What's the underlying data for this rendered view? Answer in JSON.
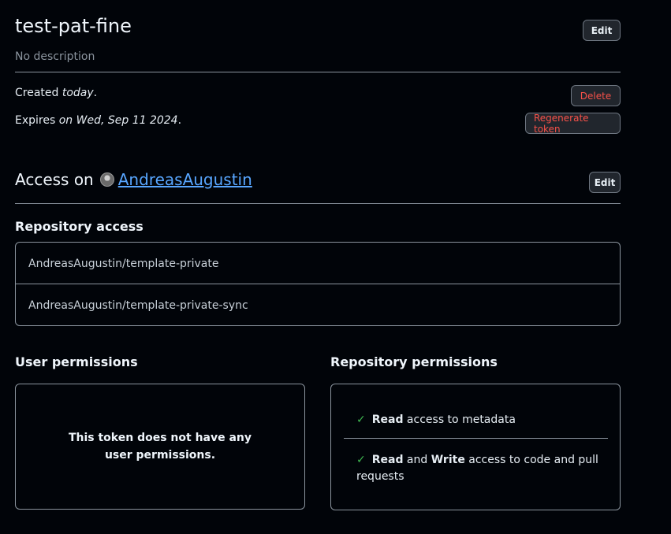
{
  "token": {
    "name": "test-pat-fine",
    "description": "No description",
    "edit_label": "Edit",
    "created_prefix": "Created ",
    "created_value": "today",
    "created_suffix": ".",
    "expires_prefix": "Expires ",
    "expires_value": "on Wed, Sep 11 2024",
    "expires_suffix": ".",
    "delete_label": "Delete",
    "regenerate_label": "Regenerate token"
  },
  "access": {
    "prefix": "Access on",
    "owner": "AndreasAugustin",
    "edit_label": "Edit"
  },
  "repository_access": {
    "heading": "Repository access",
    "repos": [
      "AndreasAugustin/template-private",
      "AndreasAugustin/template-private-sync"
    ]
  },
  "user_permissions": {
    "heading": "User permissions",
    "empty_text": "This token does not have any user permissions."
  },
  "repository_permissions": {
    "heading": "Repository permissions",
    "items": [
      {
        "parts": [
          "Read",
          " access to metadata"
        ]
      },
      {
        "parts": [
          "Read",
          " and ",
          "Write",
          " access to code and pull requests"
        ]
      }
    ]
  },
  "colors": {
    "background": "#010409",
    "link": "#58a6ff",
    "danger": "#f85149",
    "success": "#3fb950"
  },
  "icons": [
    "avatar",
    "check-icon"
  ]
}
